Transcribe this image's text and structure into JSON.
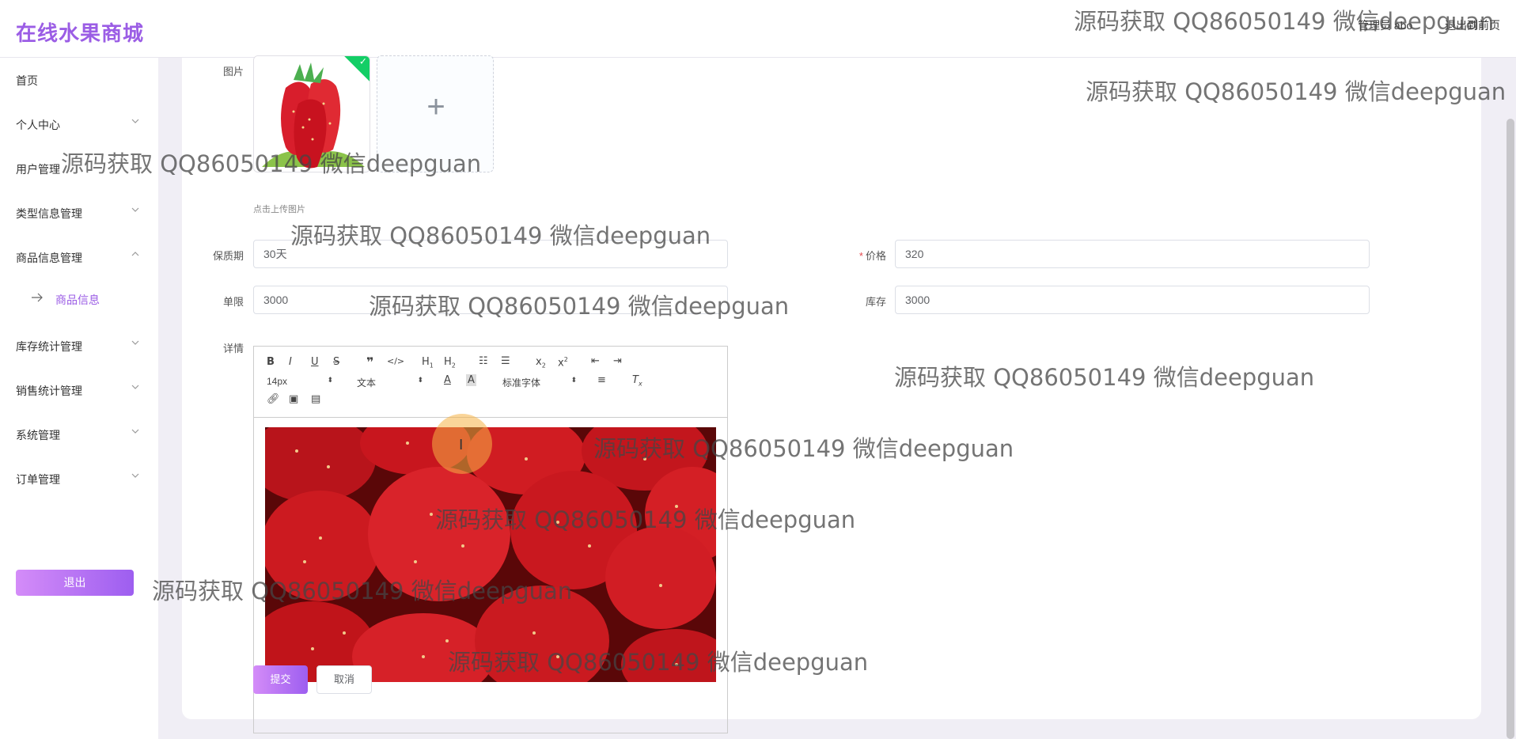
{
  "header": {
    "logo": "在线水果商城",
    "user_label": "管理员 abo",
    "back_home": "退出到前页"
  },
  "sidebar": {
    "items": [
      {
        "label": "首页"
      },
      {
        "label": "个人中心"
      },
      {
        "label": "用户管理"
      },
      {
        "label": "类型信息管理"
      },
      {
        "label": "商品信息管理"
      },
      {
        "label": "库存统计管理"
      },
      {
        "label": "销售统计管理"
      },
      {
        "label": "系统管理"
      },
      {
        "label": "订单管理"
      }
    ],
    "subitem": "商品信息",
    "logout": "退出"
  },
  "form": {
    "image_label": "图片",
    "upload_tip": "点击上传图片",
    "shelf_life_label": "保质期",
    "shelf_life_value": "30天",
    "price_label": "价格",
    "price_value": "320",
    "unit_label": "单限",
    "unit_value": "3000",
    "stock_label": "库存",
    "stock_value": "3000",
    "detail_label": "详情",
    "submit": "提交",
    "cancel": "取消"
  },
  "editor": {
    "font_size": "14px",
    "header_select": "文本",
    "font_family": "标准字体"
  },
  "watermark": "源码获取 QQ86050149 微信deepguan",
  "colors": {
    "brand": "#9b5de5",
    "accent_gradient_start": "#d48cf8",
    "accent_gradient_end": "#9d5ef0",
    "success": "#13ce66"
  }
}
